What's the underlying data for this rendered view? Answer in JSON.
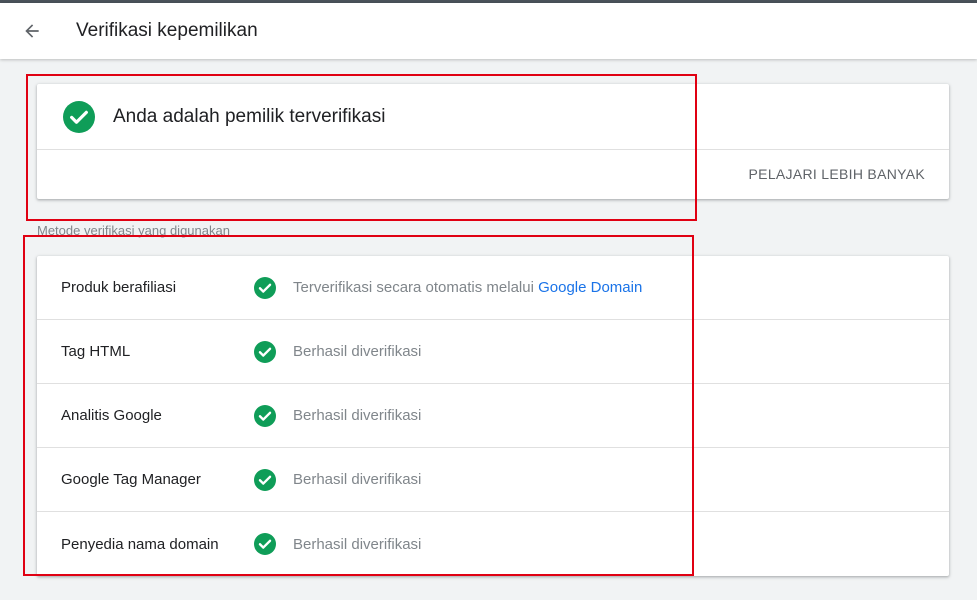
{
  "header": {
    "back_icon": "arrow-back-icon",
    "title": "Verifikasi kepemilikan"
  },
  "status": {
    "icon": "check-circle-icon",
    "text": "Anda adalah pemilik terverifikasi",
    "learn_more": "PELAJARI LEBIH BANYAK"
  },
  "methods": {
    "section_label": "Metode verifikasi yang digunakan",
    "rows": [
      {
        "name": "Produk berafiliasi",
        "status": "Terverifikasi secara otomatis melalui",
        "link": "Google Domain"
      },
      {
        "name": "Tag HTML",
        "status": "Berhasil diverifikasi"
      },
      {
        "name": "Analitis Google",
        "status": "Berhasil diverifikasi"
      },
      {
        "name": "Google Tag Manager",
        "status": "Berhasil diverifikasi"
      },
      {
        "name": "Penyedia nama domain",
        "status": "Berhasil diverifikasi"
      }
    ]
  },
  "colors": {
    "success": "#0f9d58",
    "link": "#1a73e8",
    "annotation": "#e00012"
  }
}
